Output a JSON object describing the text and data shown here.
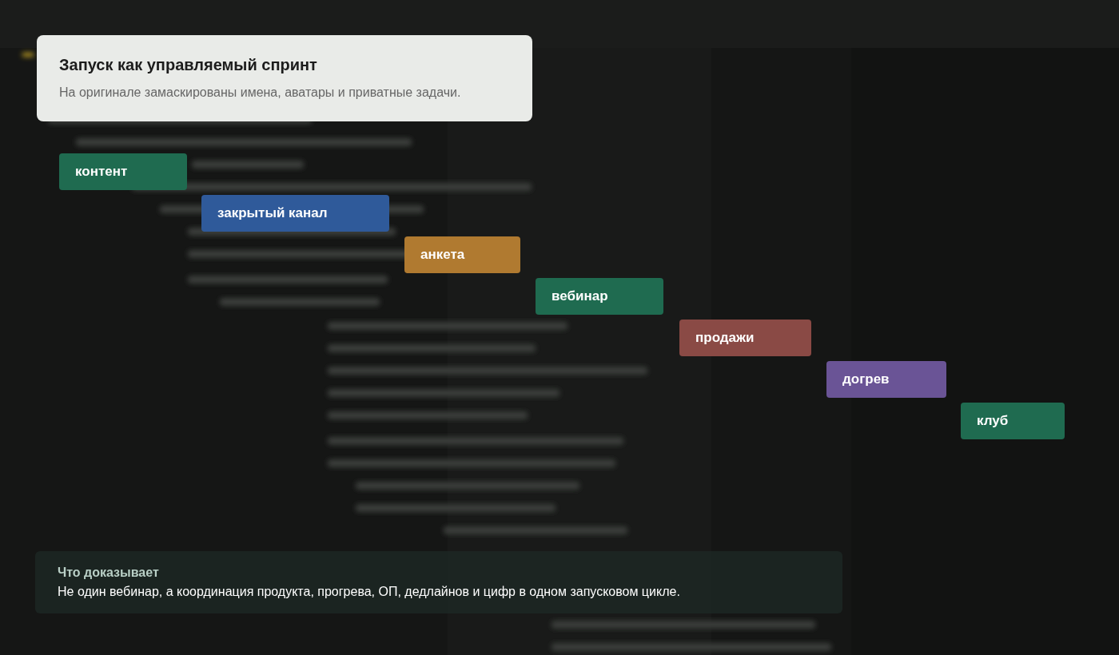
{
  "header_card": {
    "title": "Запуск как управляемый спринт",
    "subtitle": "На оригинале замаскированы имена, аватары и приватные задачи."
  },
  "stages": [
    {
      "label": "контент",
      "color": "#1f6b50"
    },
    {
      "label": "закрытый канал",
      "color": "#2f5a9a"
    },
    {
      "label": "анкета",
      "color": "#b07a30"
    },
    {
      "label": "вебинар",
      "color": "#1f6b50"
    },
    {
      "label": "продажи",
      "color": "#8a4a45"
    },
    {
      "label": "догрев",
      "color": "#6a5496"
    },
    {
      "label": "клуб",
      "color": "#1f6b50"
    }
  ],
  "proof_panel": {
    "title": "Что доказывает",
    "text": "Не один вебинар, а координация продукта, прогрева, ОП, дедлайнов и цифр в одном запусковом цикле."
  }
}
